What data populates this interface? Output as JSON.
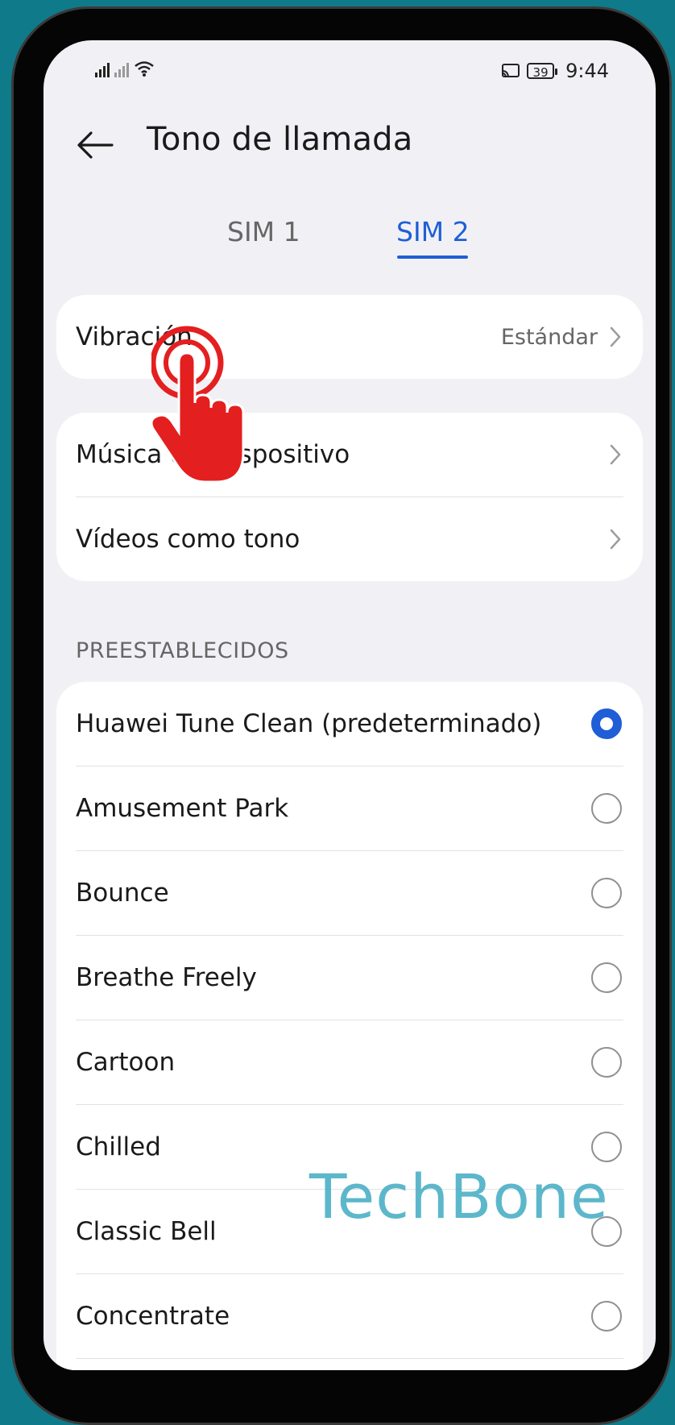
{
  "status_bar": {
    "time": "9:44",
    "battery": "39",
    "icons": [
      "signal-icon",
      "signal-icon",
      "wifi-icon",
      "cast-icon",
      "battery-icon"
    ]
  },
  "header": {
    "back_icon": "arrow-left-icon",
    "title": "Tono de llamada"
  },
  "tabs": [
    {
      "label": "SIM 1",
      "active": false
    },
    {
      "label": "SIM 2",
      "active": true
    }
  ],
  "settings": {
    "vibration": {
      "label": "Vibración",
      "value": "Estándar"
    },
    "sources": [
      {
        "label": "Música del dispositivo"
      },
      {
        "label": "Vídeos como tono"
      }
    ]
  },
  "presets": {
    "section_title": "PREESTABLECIDOS",
    "items": [
      {
        "label": "Huawei Tune Clean (predeterminado)",
        "selected": true
      },
      {
        "label": "Amusement Park",
        "selected": false
      },
      {
        "label": "Bounce",
        "selected": false
      },
      {
        "label": "Breathe Freely",
        "selected": false
      },
      {
        "label": "Cartoon",
        "selected": false
      },
      {
        "label": "Chilled",
        "selected": false
      },
      {
        "label": "Classic Bell",
        "selected": false
      },
      {
        "label": "Concentrate",
        "selected": false
      }
    ]
  },
  "overlay": {
    "hand_icon": "tap-hand-icon",
    "watermark": "TechBone"
  },
  "colors": {
    "accent": "#1f5ed6",
    "background": "#0f7a89",
    "tap_hand": "#e41f1f",
    "watermark": "#4fb1c7"
  }
}
